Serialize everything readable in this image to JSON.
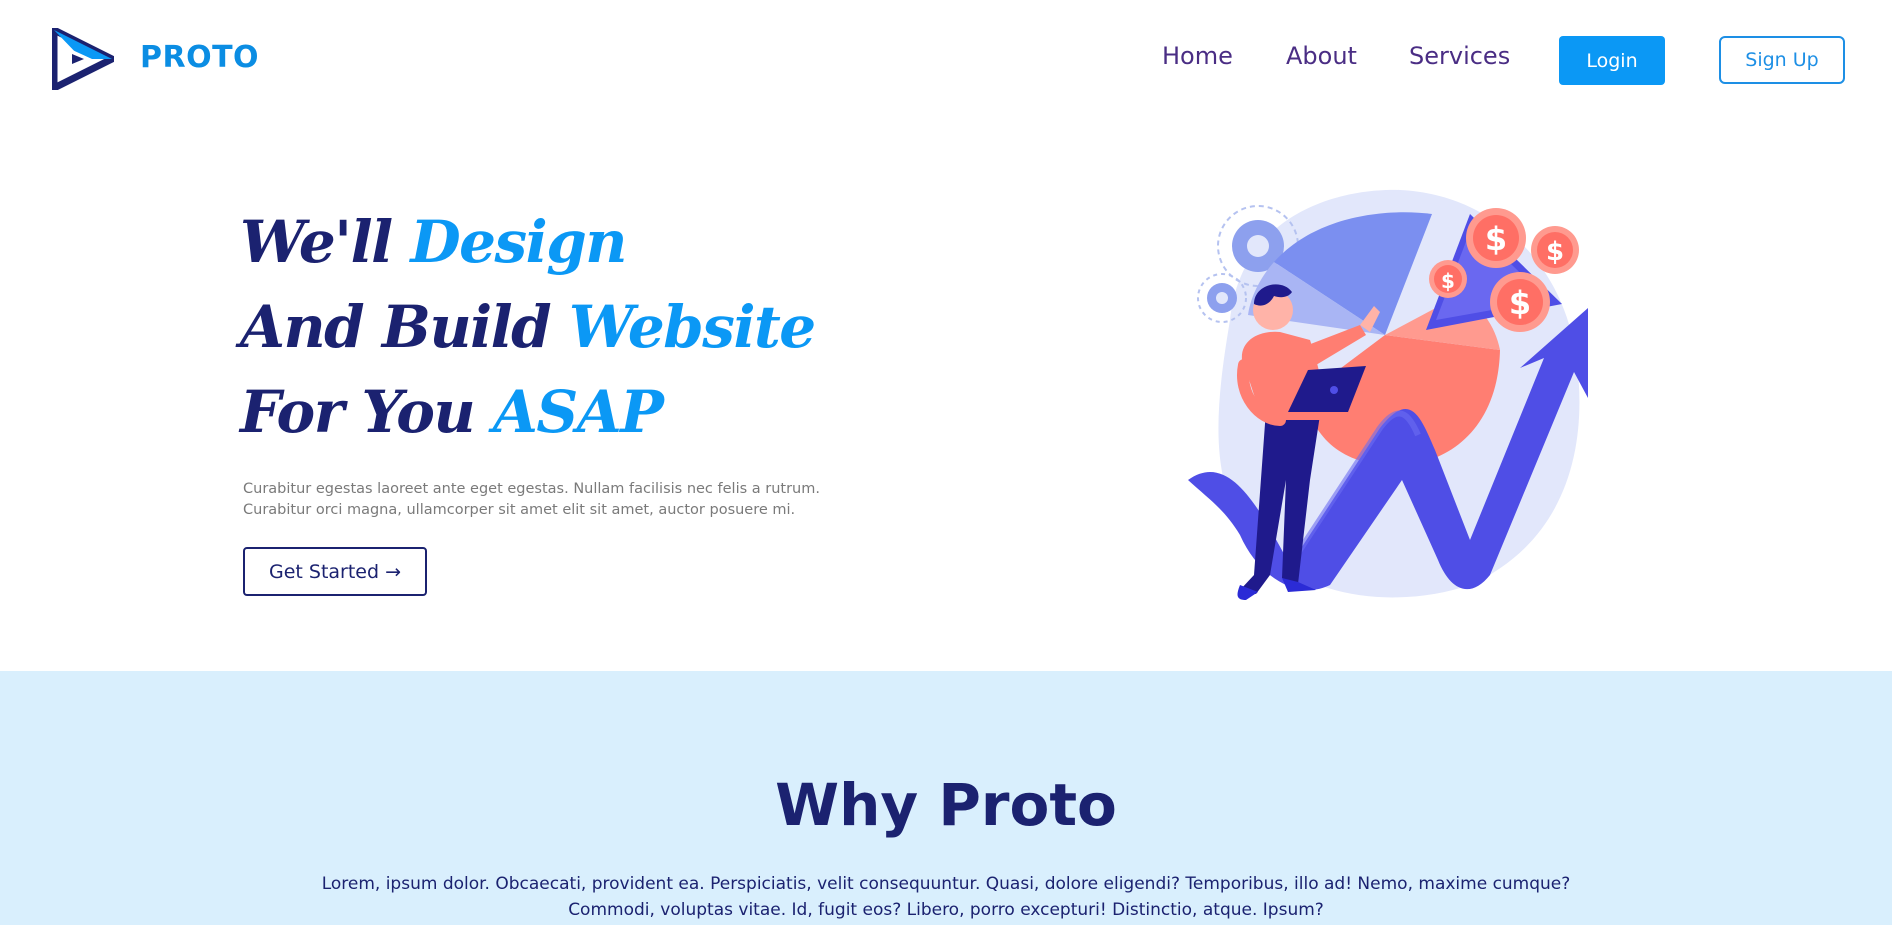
{
  "brand": {
    "name": "PROTO",
    "logo_icon": "triangle-play-logo"
  },
  "nav": {
    "links": [
      "Home",
      "About",
      "Services"
    ],
    "login_label": "Login",
    "signup_label": "Sign Up"
  },
  "hero": {
    "title_lines": [
      {
        "dark": "We'll ",
        "accent": "Design"
      },
      {
        "dark": "And Build ",
        "accent": "Website"
      },
      {
        "dark": "For You ",
        "accent": "ASAP"
      }
    ],
    "description_lines": [
      "Curabitur egestas laoreet ante eget egestas. Nullam facilisis nec felis a rutrum.",
      "Curabitur orci magna, ullamcorper sit amet elit sit amet, auctor posuere mi."
    ],
    "cta_label": "Get Started →",
    "illustration_icon": "business-growth-illustration"
  },
  "why": {
    "title": "Why Proto",
    "text_lines": [
      "Lorem, ipsum dolor. Obcaecati, provident ea. Perspiciatis, velit consequuntur. Quasi, dolore eligendi? Temporibus, illo ad! Nemo, maxime cumque?",
      "Commodi, voluptas vitae. Id, fugit eos? Libero, porro excepturi! Distinctio, atque. Ipsum?"
    ]
  },
  "colors": {
    "brand_blue": "#0b98f5",
    "navy": "#1b2270",
    "nav_purple": "#4a2d84",
    "section_bg": "#d9effd"
  }
}
